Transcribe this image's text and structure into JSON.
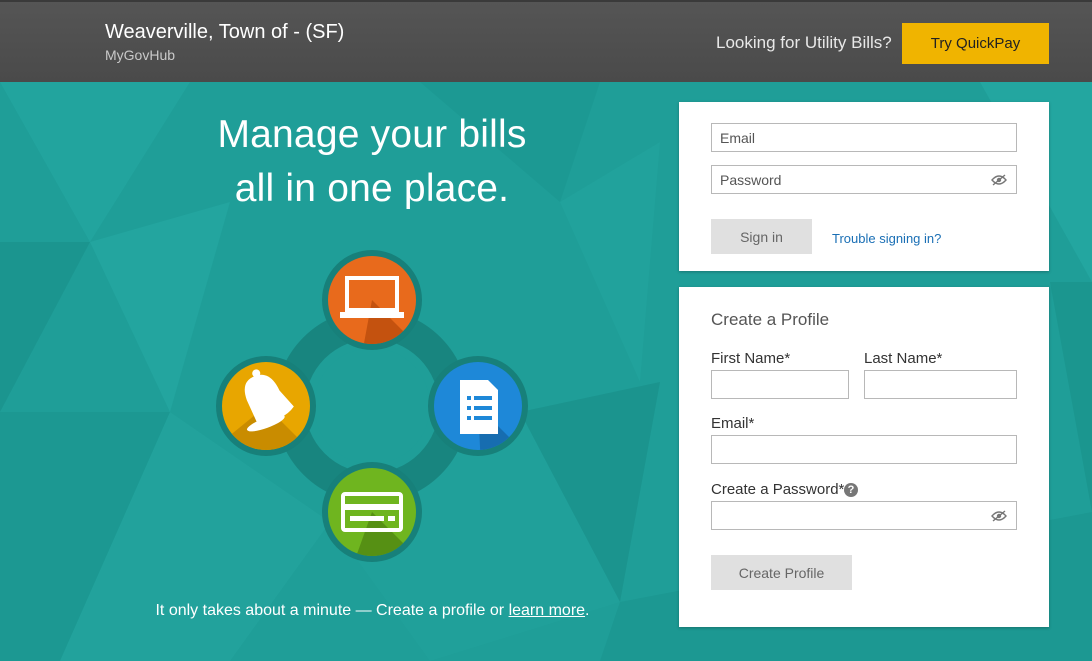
{
  "header": {
    "org_name": "Weaverville, Town of - (SF)",
    "org_sub": "MyGovHub",
    "utility_question": "Looking for Utility Bills?",
    "quickpay_label": "Try QuickPay"
  },
  "hero": {
    "title_line1": "Manage your bills",
    "title_line2": "all in one place.",
    "note_text": "It only takes about a minute — Create a profile or ",
    "note_link": "learn more",
    "note_end": ".",
    "icons": [
      "laptop-icon",
      "bell-icon",
      "document-list-icon",
      "credit-card-icon"
    ]
  },
  "signin": {
    "email_placeholder": "Email",
    "password_placeholder": "Password",
    "signin_label": "Sign in",
    "trouble_link": "Trouble signing in?"
  },
  "profile": {
    "title": "Create a Profile",
    "first_name_label": "First Name*",
    "last_name_label": "Last Name*",
    "email_label": "Email*",
    "password_label": "Create a Password*",
    "help_glyph": "?",
    "submit_label": "Create Profile"
  },
  "colors": {
    "background": "#1f9e98",
    "header": "#4d4d4d",
    "quickpay": "#f0b400",
    "laptop_circle": "#e86a1c",
    "bell_circle": "#e8a600",
    "doc_circle": "#1e88d8",
    "card_circle": "#6fb51f",
    "link": "#1a6fb5"
  }
}
